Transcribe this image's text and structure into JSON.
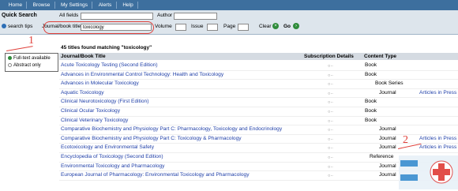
{
  "nav": {
    "tabs": [
      "Home",
      "Browse",
      "My Settings",
      "Alerts",
      "Help"
    ]
  },
  "quick_search": {
    "title": "Quick Search",
    "all_fields_label": "All fields",
    "all_fields_value": "",
    "author_label": "Author",
    "author_value": "",
    "search_tips_label": "search tips",
    "journal_label": "Journal/book title",
    "journal_value": "toxicology",
    "volume_label": "Volume",
    "issue_label": "Issue",
    "page_label": "Page",
    "clear_label": "Clear",
    "go_label": "Go"
  },
  "legend": {
    "full_text": "Full-text available",
    "abstract_only": "Abstract only"
  },
  "annotations": {
    "one": "1",
    "two": "2"
  },
  "results": {
    "found_text": "45 titles found matching \"toxicology\"",
    "headers": {
      "title": "Journal/Book Title",
      "subscription": "Subscription Details",
      "content_type": "Content Type"
    },
    "rows": [
      {
        "title": "Acute Toxicology Testing (Second Edition)",
        "type": "Book",
        "aip": ""
      },
      {
        "title": "Advances in Environmental Control Technology: Health and Toxicology",
        "type": "Book",
        "aip": ""
      },
      {
        "title": "Advances in Molecular Toxicology",
        "type": "Book Series",
        "aip": ""
      },
      {
        "title": "Aquatic Toxicology",
        "type": "Journal",
        "aip": "Articles in Press"
      },
      {
        "title": "Clinical Neurotoxicology (First Edition)",
        "type": "Book",
        "aip": ""
      },
      {
        "title": "Clinical Ocular Toxicology",
        "type": "Book",
        "aip": ""
      },
      {
        "title": "Clinical Veterinary Toxicology",
        "type": "Book",
        "aip": ""
      },
      {
        "title": "Comparative Biochemistry and Physiology Part C: Pharmacology, Toxicology and Endocrinology",
        "type": "Journal",
        "aip": ""
      },
      {
        "title": "Comparative Biochemistry and Physiology Part C: Toxicology & Pharmacology",
        "type": "Journal",
        "aip": "Articles in Press"
      },
      {
        "title": "Ecotoxicology and Environmental Safety",
        "type": "Journal",
        "aip": "Articles in Press"
      },
      {
        "title": "Encyclopedia of Toxicology (Second Edition)",
        "type": "Reference",
        "aip": ""
      },
      {
        "title": "Environmental Toxicology and Pharmacology",
        "type": "Journal",
        "aip": ""
      },
      {
        "title": "European Journal of Pharmacology: Environmental Toxicology and Pharmacology",
        "type": "Journal",
        "aip": ""
      }
    ]
  }
}
